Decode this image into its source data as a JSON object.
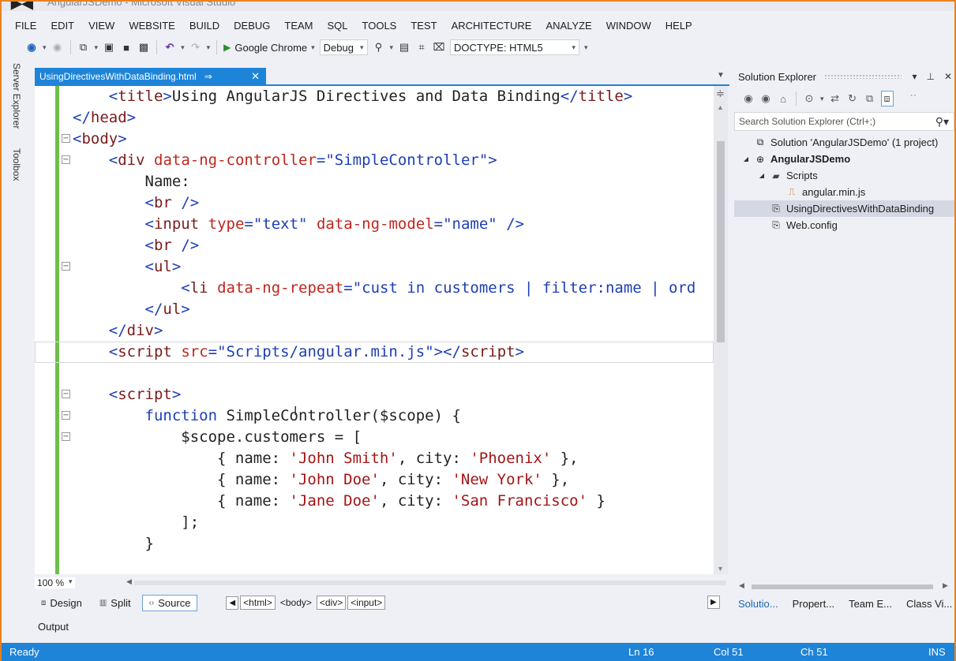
{
  "window": {
    "title": "AngularJSDemo - Microsoft Visual Studio"
  },
  "menu": [
    "FILE",
    "EDIT",
    "VIEW",
    "WEBSITE",
    "BUILD",
    "DEBUG",
    "TEAM",
    "SQL",
    "TOOLS",
    "TEST",
    "ARCHITECTURE",
    "ANALYZE",
    "WINDOW",
    "HELP"
  ],
  "toolbar": {
    "run_target": "Google Chrome",
    "config": "Debug",
    "doctype": "DOCTYPE: HTML5"
  },
  "side_tabs": {
    "server_explorer": "Server Explorer",
    "toolbox": "Toolbox"
  },
  "doc_tab": {
    "name": "UsingDirectivesWithDataBinding.html",
    "pin": "⇒",
    "close": "✕"
  },
  "code_lines": [
    {
      "fold": "",
      "parts": [
        [
          "p",
          "    "
        ],
        [
          "b",
          "<"
        ],
        [
          "t",
          "title"
        ],
        [
          "b",
          ">"
        ],
        [
          "p",
          "Using AngularJS Directives and Data Binding"
        ],
        [
          "b",
          "</"
        ],
        [
          "t",
          "title"
        ],
        [
          "b",
          ">"
        ]
      ]
    },
    {
      "fold": "",
      "parts": [
        [
          "b",
          "</"
        ],
        [
          "t",
          "head"
        ],
        [
          "b",
          ">"
        ]
      ]
    },
    {
      "fold": "⊟",
      "parts": [
        [
          "b",
          "<"
        ],
        [
          "t",
          "body"
        ],
        [
          "b",
          ">"
        ]
      ]
    },
    {
      "fold": "⊟",
      "parts": [
        [
          "p",
          "    "
        ],
        [
          "b",
          "<"
        ],
        [
          "t",
          "div"
        ],
        [
          "p",
          " "
        ],
        [
          "a",
          "data-ng-controller"
        ],
        [
          "b",
          "="
        ],
        [
          "v",
          "\"SimpleController\""
        ],
        [
          "b",
          ">"
        ]
      ]
    },
    {
      "fold": "",
      "parts": [
        [
          "p",
          "        Name:"
        ]
      ]
    },
    {
      "fold": "",
      "parts": [
        [
          "p",
          "        "
        ],
        [
          "b",
          "<"
        ],
        [
          "t",
          "br"
        ],
        [
          "p",
          " "
        ],
        [
          "b",
          "/>"
        ]
      ]
    },
    {
      "fold": "",
      "parts": [
        [
          "p",
          "        "
        ],
        [
          "b",
          "<"
        ],
        [
          "t",
          "input"
        ],
        [
          "p",
          " "
        ],
        [
          "a",
          "type"
        ],
        [
          "b",
          "="
        ],
        [
          "v",
          "\"text\""
        ],
        [
          "p",
          " "
        ],
        [
          "a",
          "data-ng-model"
        ],
        [
          "b",
          "="
        ],
        [
          "v",
          "\"name\""
        ],
        [
          "p",
          " "
        ],
        [
          "b",
          "/>"
        ]
      ]
    },
    {
      "fold": "",
      "parts": [
        [
          "p",
          "        "
        ],
        [
          "b",
          "<"
        ],
        [
          "t",
          "br"
        ],
        [
          "p",
          " "
        ],
        [
          "b",
          "/>"
        ]
      ]
    },
    {
      "fold": "⊟",
      "parts": [
        [
          "p",
          "        "
        ],
        [
          "b",
          "<"
        ],
        [
          "t",
          "ul"
        ],
        [
          "b",
          ">"
        ]
      ]
    },
    {
      "fold": "",
      "parts": [
        [
          "p",
          "            "
        ],
        [
          "b",
          "<"
        ],
        [
          "t",
          "li"
        ],
        [
          "p",
          " "
        ],
        [
          "a",
          "data-ng-repeat"
        ],
        [
          "b",
          "="
        ],
        [
          "v",
          "\"cust in customers | filter:name | ord"
        ]
      ]
    },
    {
      "fold": "",
      "parts": [
        [
          "p",
          "        "
        ],
        [
          "b",
          "</"
        ],
        [
          "t",
          "ul"
        ],
        [
          "b",
          ">"
        ]
      ]
    },
    {
      "fold": "",
      "parts": [
        [
          "p",
          "    "
        ],
        [
          "b",
          "</"
        ],
        [
          "t",
          "div"
        ],
        [
          "b",
          ">"
        ]
      ]
    },
    {
      "fold": "",
      "current": true,
      "parts": [
        [
          "p",
          "    "
        ],
        [
          "b",
          "<"
        ],
        [
          "t",
          "script"
        ],
        [
          "p",
          " "
        ],
        [
          "a",
          "src"
        ],
        [
          "b",
          "="
        ],
        [
          "v",
          "\"Scripts/angular.min.js\""
        ],
        [
          "b",
          "></"
        ],
        [
          "t",
          "script"
        ],
        [
          "b",
          ">"
        ]
      ]
    },
    {
      "fold": "",
      "parts": []
    },
    {
      "fold": "⊟",
      "parts": [
        [
          "p",
          "    "
        ],
        [
          "b",
          "<"
        ],
        [
          "t",
          "script"
        ],
        [
          "b",
          ">"
        ]
      ]
    },
    {
      "fold": "⊟",
      "parts": [
        [
          "p",
          "        "
        ],
        [
          "k",
          "function"
        ],
        [
          "p",
          " SimpleController($scope) {"
        ]
      ]
    },
    {
      "fold": "⊟",
      "parts": [
        [
          "p",
          "            $scope.customers = ["
        ]
      ]
    },
    {
      "fold": "",
      "parts": [
        [
          "p",
          "                { name: "
        ],
        [
          "s",
          "'John Smith'"
        ],
        [
          "p",
          ", city: "
        ],
        [
          "s",
          "'Phoenix'"
        ],
        [
          "p",
          " },"
        ]
      ]
    },
    {
      "fold": "",
      "parts": [
        [
          "p",
          "                { name: "
        ],
        [
          "s",
          "'John Doe'"
        ],
        [
          "p",
          ", city: "
        ],
        [
          "s",
          "'New York'"
        ],
        [
          "p",
          " },"
        ]
      ]
    },
    {
      "fold": "",
      "parts": [
        [
          "p",
          "                { name: "
        ],
        [
          "s",
          "'Jane Doe'"
        ],
        [
          "p",
          ", city: "
        ],
        [
          "s",
          "'San Francisco'"
        ],
        [
          "p",
          " }"
        ]
      ]
    },
    {
      "fold": "",
      "parts": [
        [
          "p",
          "            ];"
        ]
      ]
    },
    {
      "fold": "",
      "parts": [
        [
          "p",
          "        }"
        ]
      ]
    }
  ],
  "editor_footer": {
    "zoom": "100 %",
    "views": [
      "Design",
      "Split",
      "Source"
    ],
    "breadcrumbs": [
      "<html>",
      "<body>",
      "<div>",
      "<input>"
    ]
  },
  "output_label": "Output",
  "status": {
    "ready": "Ready",
    "ln": "Ln 16",
    "col": "Col 51",
    "ch": "Ch 51",
    "ins": "INS"
  },
  "solution_explorer": {
    "title": "Solution Explorer",
    "search_placeholder": "Search Solution Explorer (Ctrl+;)",
    "tree": [
      {
        "label": "Solution 'AngularJSDemo' (1 project)",
        "level": 0,
        "exp": "",
        "icon": "solution-icon",
        "bold": false,
        "selected": false
      },
      {
        "label": "AngularJSDemo",
        "level": 0,
        "exp": "◢",
        "icon": "web-project-icon",
        "bold": true,
        "selected": false
      },
      {
        "label": "Scripts",
        "level": 1,
        "exp": "◢",
        "icon": "folder-icon",
        "bold": false,
        "selected": false
      },
      {
        "label": "angular.min.js",
        "level": 2,
        "exp": "",
        "icon": "js-file-icon",
        "bold": false,
        "selected": false
      },
      {
        "label": "UsingDirectivesWithDataBinding",
        "level": 1,
        "exp": "",
        "icon": "html-file-icon",
        "bold": false,
        "selected": true
      },
      {
        "label": "Web.config",
        "level": 1,
        "exp": "",
        "icon": "config-file-icon",
        "bold": false,
        "selected": false
      }
    ],
    "tabs": [
      "Solutio...",
      "Propert...",
      "Team E...",
      "Class Vi..."
    ]
  }
}
